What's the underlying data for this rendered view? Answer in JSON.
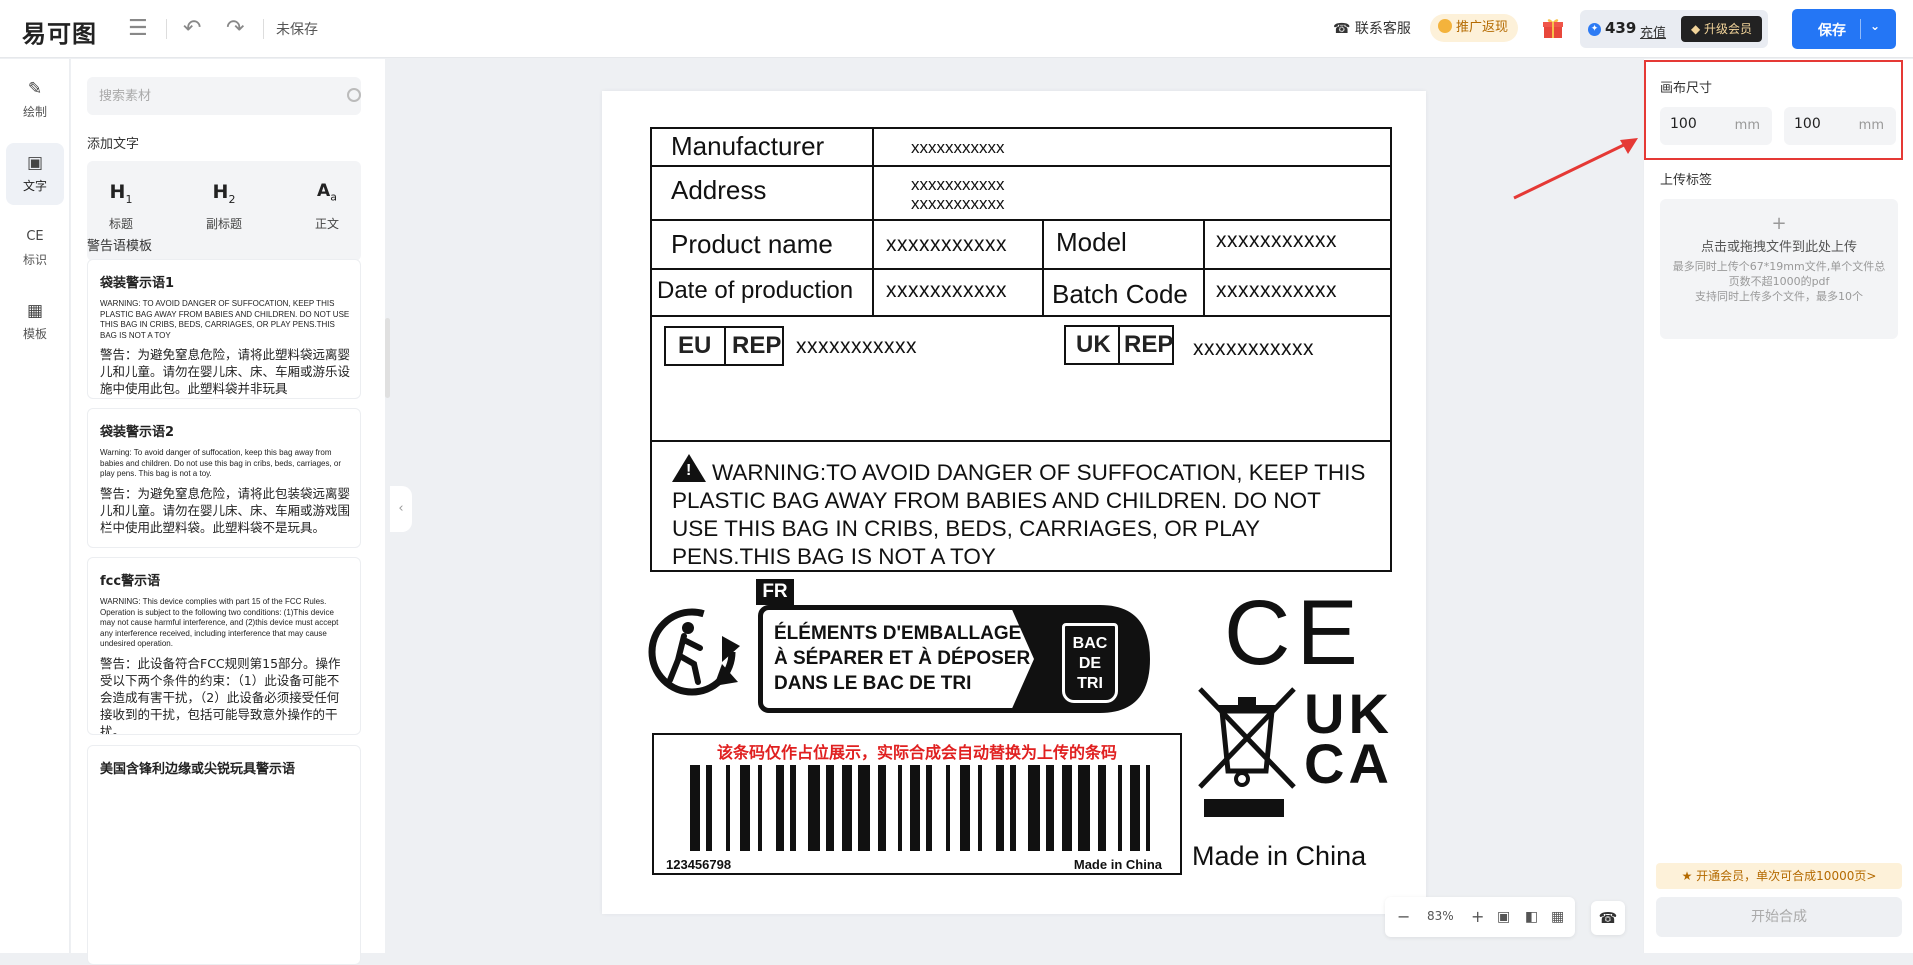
{
  "topbar": {
    "logo": "易可图",
    "unsaved": "未保存",
    "support": "联系客服",
    "promo": "推广返现",
    "points": "439",
    "recharge": "充值",
    "vip": "升级会员",
    "save": "保存"
  },
  "nav": [
    {
      "label": "绘制",
      "icon": "pen-icon"
    },
    {
      "label": "文字",
      "icon": "text-icon"
    },
    {
      "label": "标识",
      "icon": "ce-mark-icon"
    },
    {
      "label": "模板",
      "icon": "grid-icon"
    }
  ],
  "panel": {
    "search_placeholder": "搜索素材",
    "add_text": "添加文字",
    "text_options": [
      {
        "glyph": "H",
        "sub": "1",
        "label": "标题"
      },
      {
        "glyph": "H",
        "sub": "2",
        "label": "副标题"
      },
      {
        "glyph": "A",
        "sub": "a",
        "label": "正文"
      }
    ],
    "warn_templates_title": "警告语模板",
    "templates": [
      {
        "title": "袋装警示语1",
        "en": "WARNING: TO AVOID DANGER OF SUFFOCATION, KEEP THIS PLASTIC BAG AWAY FROM BABIES AND CHILDREN. DO NOT USE THIS BAG IN CRIBS, BEDS, CARRIAGES, OR PLAY PENS.THIS BAG IS NOT A TOY",
        "cn": "警告：为避免窒息危险，请将此塑料袋远离婴儿和儿童。请勿在婴儿床、床、车厢或游乐设施中使用此包。此塑料袋并非玩具"
      },
      {
        "title": "袋装警示语2",
        "en": "Warning: To avoid danger of suffocation, keep this bag away from babies and children. Do not use this bag in cribs, beds, carriages, or play pens. This bag is not a toy.",
        "cn": "警告：为避免窒息危险，请将此包装袋远离婴儿和儿童。请勿在婴儿床、床、车厢或游戏围栏中使用此塑料袋。此塑料袋不是玩具。"
      },
      {
        "title": "fcc警示语",
        "en": "WARNING: This device complies with part 15 of the FCC Rules. Operation is subject to the following two conditions: (1)This device may not cause harmful interference, and (2)this device must accept any interference received, including interference that may cause undesired operation.",
        "cn": "警告：此设备符合FCC规则第15部分。操作受以下两个条件的约束：（1）此设备可能不会造成有害干扰，（2）此设备必须接受任何接收到的干扰，包括可能导致意外操作的干扰。"
      },
      {
        "title": "美国含锋利边缘或尖锐玩具警示语",
        "en": "",
        "cn": ""
      }
    ]
  },
  "label": {
    "manufacturer": "Manufacturer",
    "manufacturer_val": "xxxxxxxxxxx",
    "address": "Address",
    "address_val1": "xxxxxxxxxxx",
    "address_val2": "xxxxxxxxxxx",
    "product_name": "Product name",
    "product_val": "xxxxxxxxxxx",
    "model": "Model",
    "model_val": "xxxxxxxxxxx",
    "date": "Date of production",
    "date_val": "xxxxxxxxxxx",
    "batch": "Batch Code",
    "batch_val": "xxxxxxxxxxx",
    "eu": "EU",
    "rep": "REP",
    "eu_val": "xxxxxxxxxxx",
    "uk": "UK",
    "uk_val": "xxxxxxxxxxx",
    "warning": "WARNING:TO AVOID DANGER OF SUFFOCATION, KEEP THIS PLASTIC BAG AWAY FROM BABIES AND CHILDREN. DO NOT USE THIS BAG IN CRIBS, BEDS, CARRIAGES, OR PLAY PENS.THIS BAG IS NOT A TOY",
    "fr": "FR",
    "triman_l1": "ÉLÉMENTS D'EMBALLAGE",
    "triman_l2": "À SÉPARER ET À DÉPOSER",
    "triman_l3": "DANS LE BAC DE TRI",
    "bac_l1": "BAC",
    "bac_l2": "DE",
    "bac_l3": "TRI",
    "ce": "CE",
    "ukca_l1": "UK",
    "ukca_l2": "CA",
    "barcode_note": "该条码仅作占位展示，实际合成会自动替换为上传的条码",
    "barcode_num": "123456798",
    "barcode_made": "Made in China",
    "made_in": "Made in China"
  },
  "zoom": {
    "value": "83%"
  },
  "right": {
    "canvas_size": "画布尺寸",
    "width": "100",
    "height": "100",
    "unit": "mm",
    "upload_title": "上传标签",
    "upload_main": "点击或拖拽文件到此处上传",
    "upload_hint1": "最多同时上传个67*19mm文件,单个文件总页数不超1000的pdf",
    "upload_hint2": "支持同时上传多个文件，最多10个",
    "vip_banner": "开通会员，单次可合成10000页>",
    "start": "开始合成"
  },
  "colors": {
    "accent": "#2476f5",
    "highlight": "#e53935",
    "barcode_note": "#e02020"
  }
}
